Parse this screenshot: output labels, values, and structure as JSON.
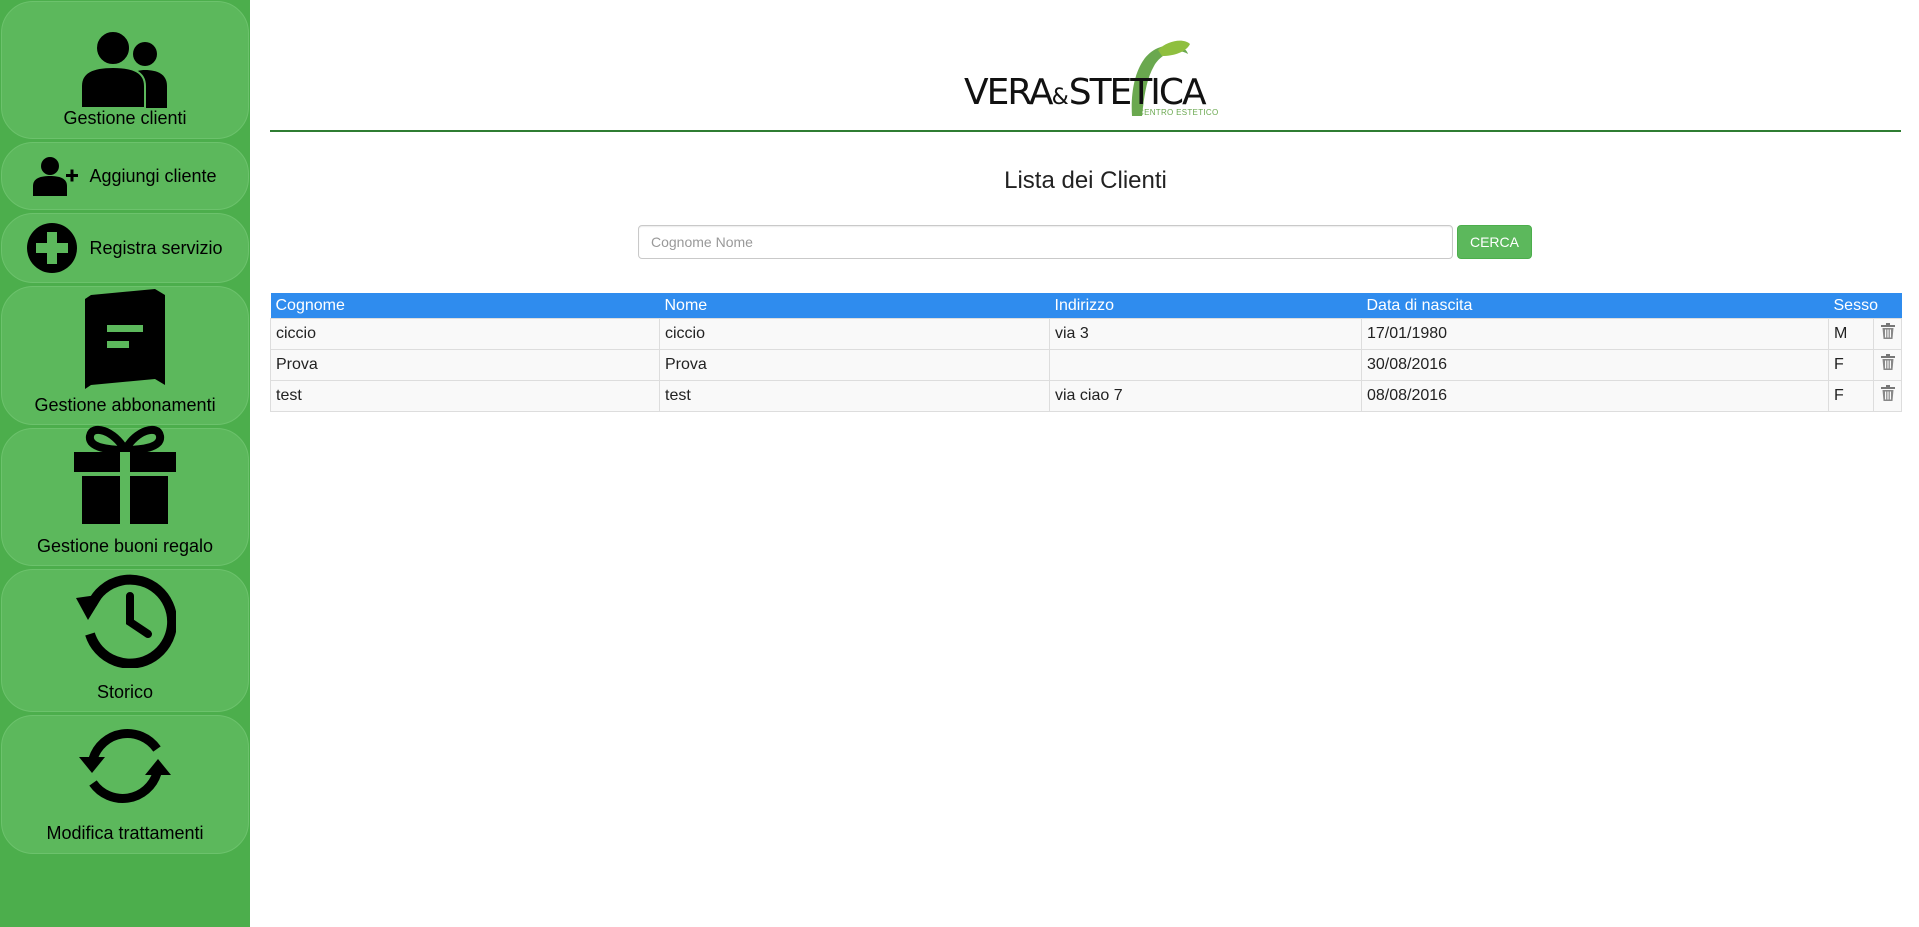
{
  "sidebar": {
    "items": [
      {
        "label": "Gestione clienti",
        "icon": "users-icon"
      },
      {
        "label": "Aggiungi cliente",
        "icon": "add-user-icon"
      },
      {
        "label": "Registra servizio",
        "icon": "plus-circle-icon"
      },
      {
        "label": "Gestione abbonamenti",
        "icon": "book-icon"
      },
      {
        "label": "Gestione buoni regalo",
        "icon": "gift-icon"
      },
      {
        "label": "Storico",
        "icon": "history-icon"
      },
      {
        "label": "Modifica trattamenti",
        "icon": "refresh-icon"
      }
    ]
  },
  "header": {
    "logo_main": "VERA",
    "logo_amp": "&",
    "logo_rest": "STETICA",
    "logo_sub": "CENTRO ESTETICO"
  },
  "main": {
    "title": "Lista dei Clienti",
    "search": {
      "placeholder": "Cognome Nome",
      "value": "",
      "button_label": "CERCA"
    },
    "table": {
      "columns": [
        "Cognome",
        "Nome",
        "Indirizzo",
        "Data di nascita",
        "Sesso"
      ],
      "rows": [
        {
          "cognome": "ciccio",
          "nome": "ciccio",
          "indirizzo": "via 3",
          "data_nascita": "17/01/1980",
          "sesso": "M"
        },
        {
          "cognome": "Prova",
          "nome": "Prova",
          "indirizzo": "",
          "data_nascita": "30/08/2016",
          "sesso": "F"
        },
        {
          "cognome": "test",
          "nome": "test",
          "indirizzo": "via ciao 7",
          "data_nascita": "08/08/2016",
          "sesso": "F"
        }
      ]
    }
  },
  "colors": {
    "sidebar_bg": "#4cae4c",
    "tile_bg": "#5cb85c",
    "table_header": "#2f8cee",
    "button": "#5cb85c",
    "divider": "#2f7d32"
  }
}
